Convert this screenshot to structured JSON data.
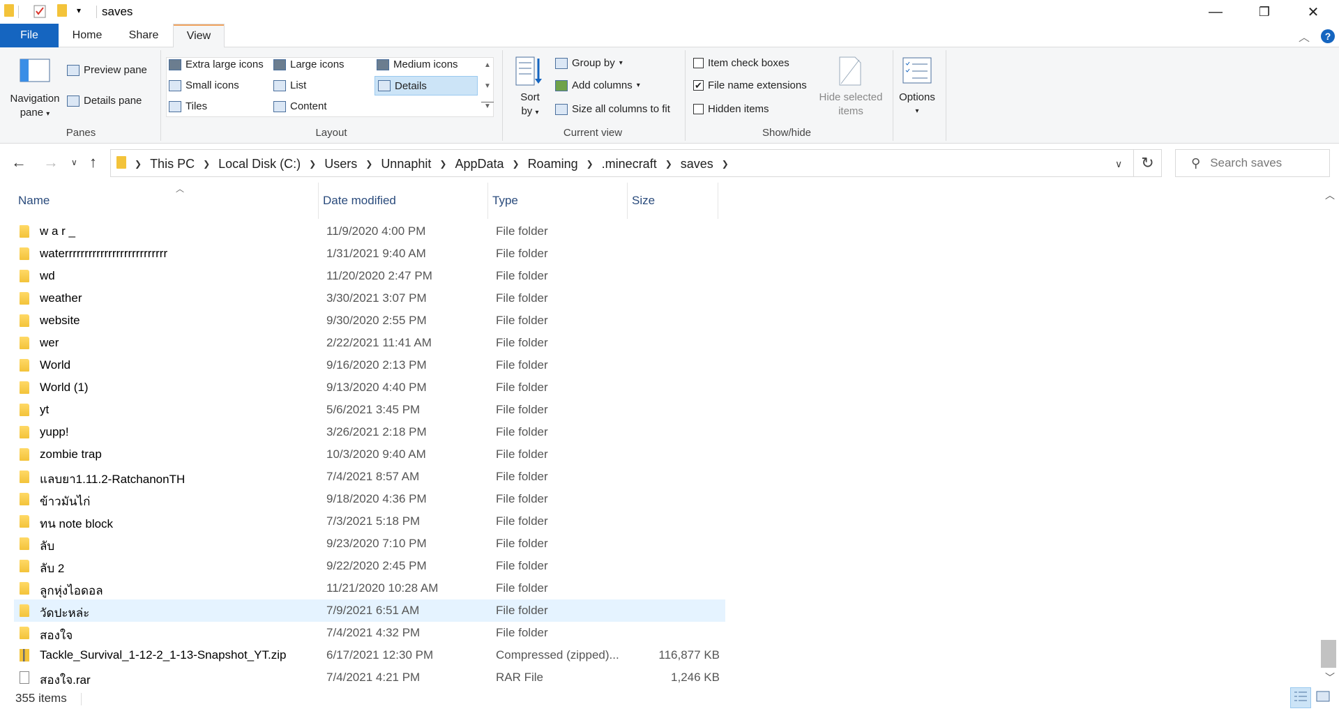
{
  "window": {
    "title": "saves",
    "minimize": "—",
    "restore": "❐",
    "close": "✕"
  },
  "ribbon_tabs": {
    "file": "File",
    "home": "Home",
    "share": "Share",
    "view": "View",
    "help": "?"
  },
  "ribbon": {
    "panes": {
      "label": "Panes",
      "navigation_pane": "Navigation pane",
      "preview_pane": "Preview pane",
      "details_pane": "Details pane"
    },
    "layout": {
      "label": "Layout",
      "options": [
        "Extra large icons",
        "Large icons",
        "Medium icons",
        "Small icons",
        "List",
        "Details",
        "Tiles",
        "Content"
      ],
      "selected": "Details"
    },
    "current_view": {
      "label": "Current view",
      "sort_by": "Sort by",
      "group_by": "Group by",
      "add_columns": "Add columns",
      "size_all_columns": "Size all columns to fit"
    },
    "show_hide": {
      "label": "Show/hide",
      "item_check_boxes": "Item check boxes",
      "item_check_boxes_checked": false,
      "file_name_extensions": "File name extensions",
      "file_name_extensions_checked": true,
      "hidden_items": "Hidden items",
      "hidden_items_checked": false,
      "hide_selected_items": "Hide selected items"
    },
    "options": "Options"
  },
  "address": {
    "breadcrumb": [
      "This PC",
      "Local Disk (C:)",
      "Users",
      "Unnaphit",
      "AppData",
      "Roaming",
      ".minecraft",
      "saves"
    ]
  },
  "search": {
    "placeholder": "Search saves"
  },
  "columns": {
    "name": "Name",
    "date_modified": "Date modified",
    "type": "Type",
    "size": "Size"
  },
  "files": [
    {
      "name": "w a r _",
      "date": "11/9/2020 4:00 PM",
      "type": "File folder",
      "size": "",
      "icon": "folder-icon"
    },
    {
      "name": "waterrrrrrrrrrrrrrrrrrrrrrrrrr",
      "date": "1/31/2021 9:40 AM",
      "type": "File folder",
      "size": "",
      "icon": "folder-icon"
    },
    {
      "name": "wd",
      "date": "11/20/2020 2:47 PM",
      "type": "File folder",
      "size": "",
      "icon": "folder-icon"
    },
    {
      "name": "weather",
      "date": "3/30/2021 3:07 PM",
      "type": "File folder",
      "size": "",
      "icon": "folder-icon"
    },
    {
      "name": "website",
      "date": "9/30/2020 2:55 PM",
      "type": "File folder",
      "size": "",
      "icon": "folder-icon"
    },
    {
      "name": "wer",
      "date": "2/22/2021 11:41 AM",
      "type": "File folder",
      "size": "",
      "icon": "folder-icon"
    },
    {
      "name": "World",
      "date": "9/16/2020 2:13 PM",
      "type": "File folder",
      "size": "",
      "icon": "folder-icon"
    },
    {
      "name": "World (1)",
      "date": "9/13/2020 4:40 PM",
      "type": "File folder",
      "size": "",
      "icon": "folder-icon"
    },
    {
      "name": "yt",
      "date": "5/6/2021 3:45 PM",
      "type": "File folder",
      "size": "",
      "icon": "folder-icon"
    },
    {
      "name": "yupp!",
      "date": "3/26/2021 2:18 PM",
      "type": "File folder",
      "size": "",
      "icon": "folder-icon"
    },
    {
      "name": "zombie trap",
      "date": "10/3/2020 9:40 AM",
      "type": "File folder",
      "size": "",
      "icon": "folder-icon"
    },
    {
      "name": "แลบยา1.11.2-RatchanonTH",
      "date": "7/4/2021 8:57 AM",
      "type": "File folder",
      "size": "",
      "icon": "folder-icon"
    },
    {
      "name": "ข้าวมันไก่",
      "date": "9/18/2020 4:36 PM",
      "type": "File folder",
      "size": "",
      "icon": "folder-icon"
    },
    {
      "name": "ทน note block",
      "date": "7/3/2021 5:18 PM",
      "type": "File folder",
      "size": "",
      "icon": "folder-icon"
    },
    {
      "name": "ลับ",
      "date": "9/23/2020 7:10 PM",
      "type": "File folder",
      "size": "",
      "icon": "folder-icon"
    },
    {
      "name": "ลับ 2",
      "date": "9/22/2020 2:45 PM",
      "type": "File folder",
      "size": "",
      "icon": "folder-icon"
    },
    {
      "name": "ลูกหุ่งไอดอล",
      "date": "11/21/2020 10:28 AM",
      "type": "File folder",
      "size": "",
      "icon": "folder-icon"
    },
    {
      "name": "วัดปะหล่ะ",
      "date": "7/9/2021 6:51 AM",
      "type": "File folder",
      "size": "",
      "icon": "folder-icon",
      "selected": true
    },
    {
      "name": "สองใจ",
      "date": "7/4/2021 4:32 PM",
      "type": "File folder",
      "size": "",
      "icon": "folder-icon"
    },
    {
      "name": "Tackle_Survival_1-12-2_1-13-Snapshot_YT.zip",
      "date": "6/17/2021 12:30 PM",
      "type": "Compressed (zipped)...",
      "size": "116,877 KB",
      "icon": "zip-file-icon"
    },
    {
      "name": "สองใจ.rar",
      "date": "7/4/2021 4:21 PM",
      "type": "RAR File",
      "size": "1,246 KB",
      "icon": "file-icon"
    }
  ],
  "status": {
    "item_count": "355 items"
  }
}
